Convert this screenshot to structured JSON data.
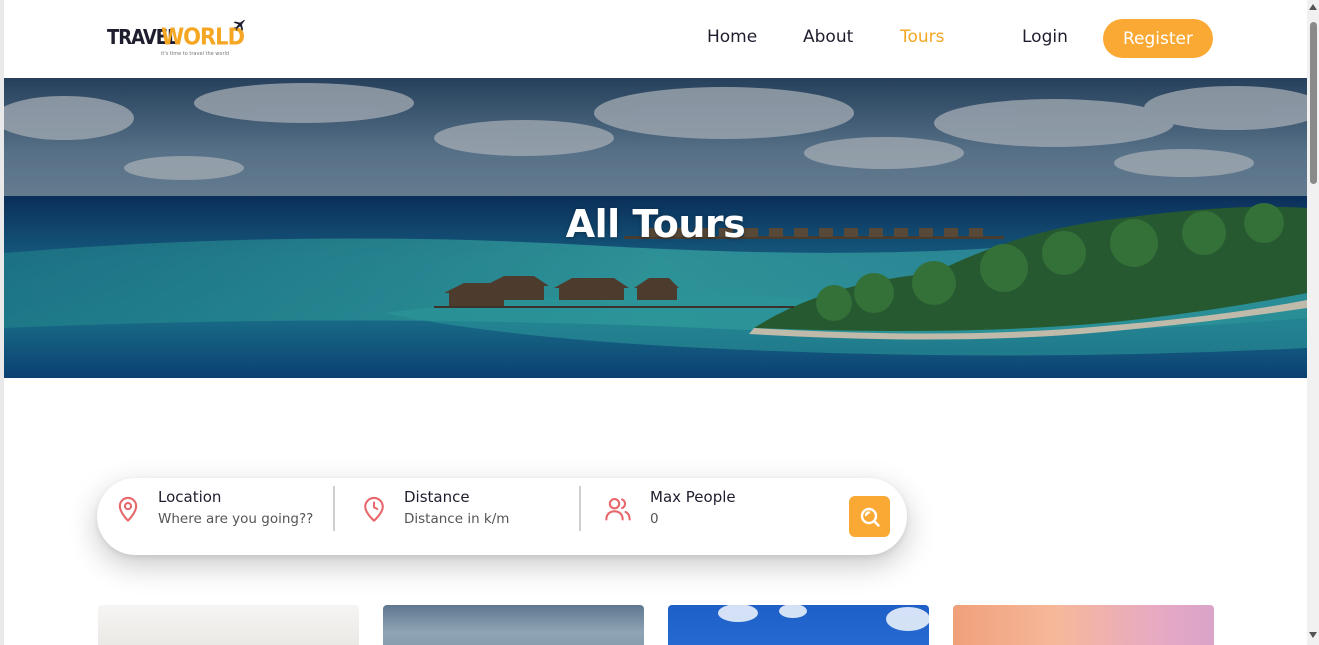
{
  "logo": {
    "part1": "TRAVEL",
    "part2": "WORLD",
    "tagline": "it's time to travel the world"
  },
  "nav": {
    "items": [
      "Home",
      "About",
      "Tours",
      "Login"
    ],
    "active": "Tours",
    "register_label": "Register"
  },
  "hero": {
    "title": "All Tours"
  },
  "search": {
    "location": {
      "label": "Location",
      "placeholder": "Where are you going??",
      "icon": "map-pin-icon"
    },
    "distance": {
      "label": "Distance",
      "placeholder": "Distance in k/m",
      "icon": "clock-pin-icon"
    },
    "max_people": {
      "label": "Max People",
      "placeholder": "0",
      "icon": "group-icon"
    },
    "button_icon": "search-icon"
  },
  "colors": {
    "accent": "#faa935",
    "icon_red": "#e8676b",
    "text_dark": "#1e1e2e"
  }
}
